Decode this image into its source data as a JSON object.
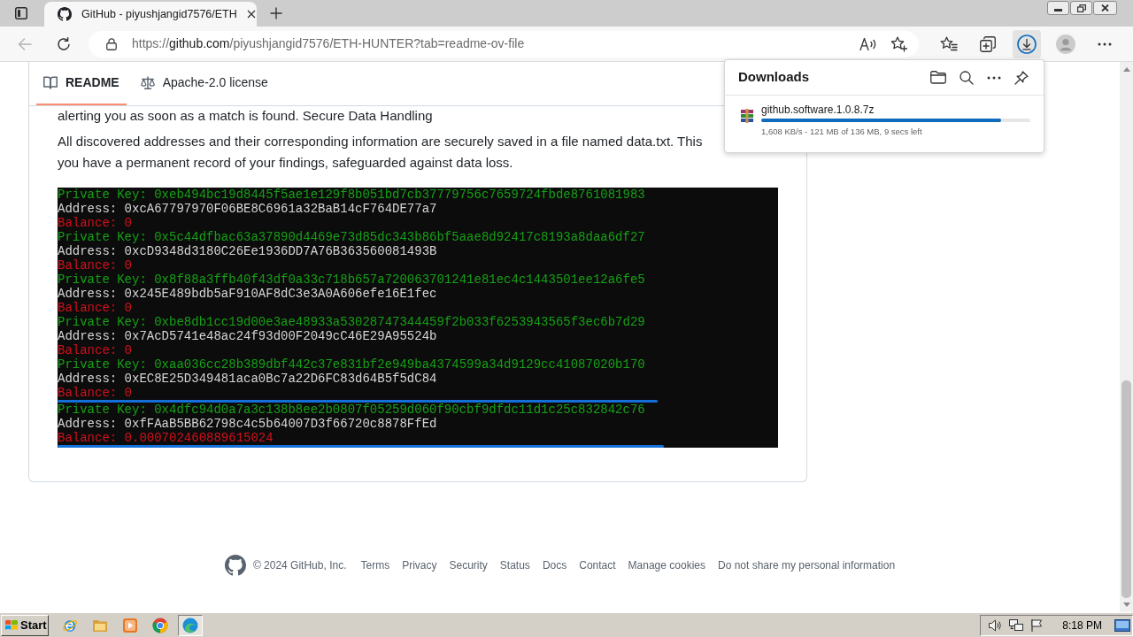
{
  "browser": {
    "tabs": [
      {
        "title": "GitHub - piyushjangid7576/ETH",
        "selected": true
      }
    ],
    "back": {
      "disabled": true
    },
    "address_bar": {
      "scheme": "https://",
      "host": "github.com",
      "path": "/piyushjangid7576/ETH-HUNTER?tab=readme-ov-file"
    },
    "toolbar_buttons": [
      {
        "kind": "favorites",
        "selected": false
      },
      {
        "kind": "collections",
        "selected": false
      },
      {
        "kind": "downloads",
        "selected": true
      },
      {
        "kind": "profile",
        "selected": false
      },
      {
        "kind": "more",
        "selected": false
      }
    ]
  },
  "readme": {
    "tabs": [
      {
        "kind": "readme",
        "label": "README",
        "selected": true
      },
      {
        "kind": "license",
        "label": "Apache-2.0 license",
        "selected": false
      }
    ],
    "partly_hidden_line": "alerting you as soon as a match is found. Secure Data Handling",
    "paragraph_lines": [
      "All discovered addresses and their corresponding information are securely saved in a file named data.txt. This",
      "you have a permanent record of your findings, safeguarded against data loss."
    ],
    "terminal": {
      "entries": [
        {
          "private_key": "Private Key: 0xeb494bc19d8445f5ae1e129f8b051bd7cb37779756c7659724fbde8761081983",
          "address": "Address: 0xcA67797970F06BE8C6961a32BaB14cF764DE77a7",
          "balance": "Balance: 0",
          "highlighted": false
        },
        {
          "private_key": "Private Key: 0x5c44dfbac63a37890d4469e73d85dc343b86bf5aae8d92417c8193a8daa6df27",
          "address": "Address: 0xcD9348d3180C26Ee1936DD7A76B363560081493B",
          "balance": "Balance: 0",
          "highlighted": false
        },
        {
          "private_key": "Private Key: 0x8f88a3ffb40f43df0a33c718b657a720063701241e81ec4c1443501ee12a6fe5",
          "address": "Address: 0x245E489bdb5aF910AF8dC3e3A0A606efe16E1fec",
          "balance": "Balance: 0",
          "highlighted": false
        },
        {
          "private_key": "Private Key: 0xbe8db1cc19d00e3ae48933a53028747344459f2b033f6253943565f3ec6b7d29",
          "address": "Address: 0x7AcD5741e48ac24f93d00F2049cC46E29A95524b",
          "balance": "Balance: 0",
          "highlighted": false
        },
        {
          "private_key": "Private Key: 0xaa036cc28b389dbf442c37e831bf2e949ba4374599a34d9129cc41087020b170",
          "address": "Address: 0xEC8E25D349481aca0Bc7a22D6FC83d64B5f5dC84",
          "balance": "Balance: 0",
          "highlighted": false
        },
        {
          "private_key": "Private Key: 0x4dfc94d0a7a3c138b8ee2b0807f05259d060f90cbf9dfdc11d1c25c832842c76",
          "address": "Address: 0xfFAaB5BB62798c4c5b64007D3f66720c8878FfEd",
          "balance": "Balance: 0.000702460889615024",
          "highlighted": true
        }
      ]
    }
  },
  "downloads_panel": {
    "title": "Downloads",
    "items": [
      {
        "file_name": "github.software.1.0.8.7z",
        "level": 0.89,
        "status": "1,608 KB/s - 121 MB of 136 MB, 9 secs left"
      }
    ]
  },
  "footer": {
    "copyright": "© 2024 GitHub, Inc.",
    "links": [
      "Terms",
      "Privacy",
      "Security",
      "Status",
      "Docs",
      "Contact",
      "Manage cookies",
      "Do not share my personal information"
    ]
  },
  "taskbar": {
    "start": "Start",
    "quick_launch": [
      {
        "kind": "ie",
        "selected": false
      },
      {
        "kind": "folder",
        "selected": false
      },
      {
        "kind": "player",
        "selected": false
      },
      {
        "kind": "chrome",
        "selected": false
      },
      {
        "kind": "edge",
        "selected": true
      }
    ],
    "clock": "8:18 PM"
  }
}
